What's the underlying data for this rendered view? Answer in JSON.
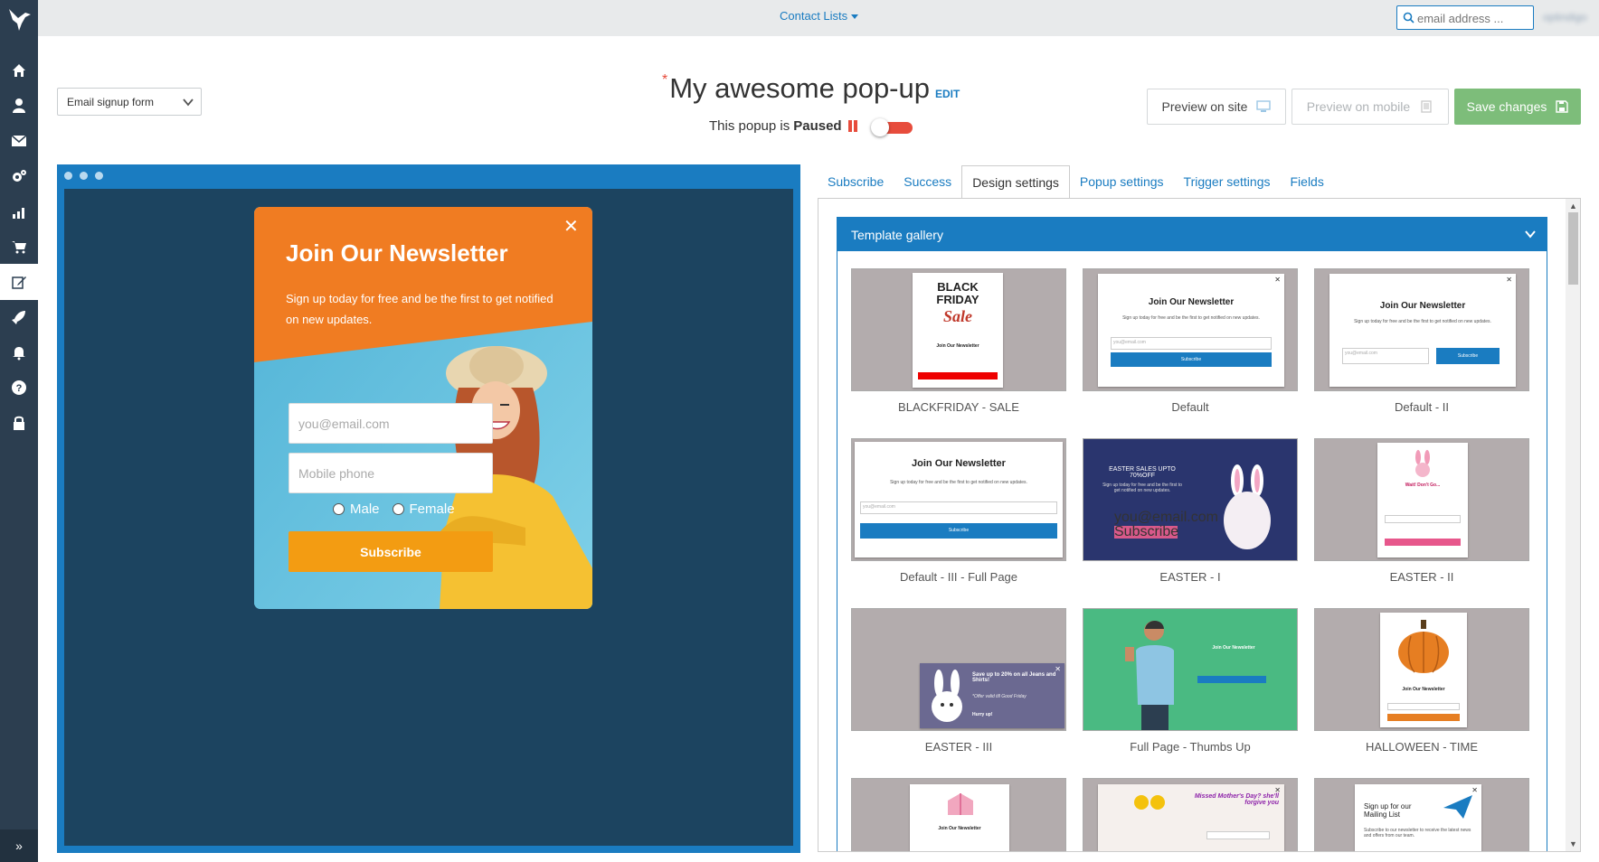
{
  "app": {
    "brand_icon": "hummingbird-logo-icon"
  },
  "sidebar": {
    "items": [
      {
        "name": "home",
        "icon": "home-icon"
      },
      {
        "name": "contacts",
        "icon": "user-icon"
      },
      {
        "name": "email",
        "icon": "envelope-icon"
      },
      {
        "name": "automation",
        "icon": "gears-icon"
      },
      {
        "name": "reports",
        "icon": "bar-chart-icon"
      },
      {
        "name": "ecommerce",
        "icon": "cart-icon"
      },
      {
        "name": "forms",
        "icon": "edit-icon",
        "active": true
      },
      {
        "name": "campaigns",
        "icon": "rocket-icon"
      },
      {
        "name": "notifications",
        "icon": "bell-icon"
      },
      {
        "name": "help",
        "icon": "question-icon"
      },
      {
        "name": "security",
        "icon": "lock-icon"
      }
    ],
    "collapse_label": "»"
  },
  "topbar": {
    "menu_label": "Contact Lists",
    "search_placeholder": "email address ...",
    "user_label": "optindigo"
  },
  "form_type": {
    "selected": "Email signup form"
  },
  "header": {
    "required_mark": "*",
    "title": "My awesome pop-up",
    "edit_label": "EDIT",
    "status_prefix": "This popup is",
    "status_value": "Paused",
    "toggle_on": false
  },
  "actions": {
    "preview_site": "Preview on site",
    "preview_mobile": "Preview on mobile",
    "save": "Save changes"
  },
  "popup_preview": {
    "title": "Join Our Newsletter",
    "subtitle": "Sign up today for free and be the first to get notified on new updates.",
    "email_placeholder": "you@email.com",
    "phone_placeholder": "Mobile phone",
    "gender_options": [
      "Male",
      "Female"
    ],
    "submit_label": "Subscribe",
    "close_label": "✕",
    "colors": {
      "header": "#f07c22",
      "button": "#f39c12",
      "background": "#5ab6d7"
    }
  },
  "tabs": [
    {
      "label": "Subscribe",
      "active": false
    },
    {
      "label": "Success",
      "active": false
    },
    {
      "label": "Design settings",
      "active": true
    },
    {
      "label": "Popup settings",
      "active": false
    },
    {
      "label": "Trigger settings",
      "active": false
    },
    {
      "label": "Fields",
      "active": false
    }
  ],
  "gallery": {
    "header": "Template gallery",
    "templates": [
      {
        "label": "BLACKFRIDAY - SALE"
      },
      {
        "label": "Default"
      },
      {
        "label": "Default - II"
      },
      {
        "label": "Default - III - Full Page"
      },
      {
        "label": "EASTER - I"
      },
      {
        "label": "EASTER - II"
      },
      {
        "label": "EASTER - III"
      },
      {
        "label": "Full Page - Thumbs Up"
      },
      {
        "label": "HALLOWEEN - TIME"
      }
    ],
    "thumb_text": {
      "black": "BLACK",
      "friday": "FRIDAY",
      "sale": "Sale",
      "join": "Join Our Newsletter",
      "signup": "Sign up today for free and be the first to get notified on new updates.",
      "email": "you@email.com",
      "subscribe": "Subscribe",
      "easter_sales": "EASTER SALES UPTO 70%OFF",
      "wait": "Wait! Don't Go...",
      "save_up": "Save up to 20% on all Jeans and Shirts!",
      "offer": "*Offer valid till Good Friday",
      "hurry": "Hurry up!",
      "mothers_day": "Missed Mother's Day? she'll forgive you",
      "sign_up_for": "Sign up for our Mailing List",
      "subscribe_note": "Subscribe to our newsletter to receive the latest news and offers from our team."
    }
  }
}
